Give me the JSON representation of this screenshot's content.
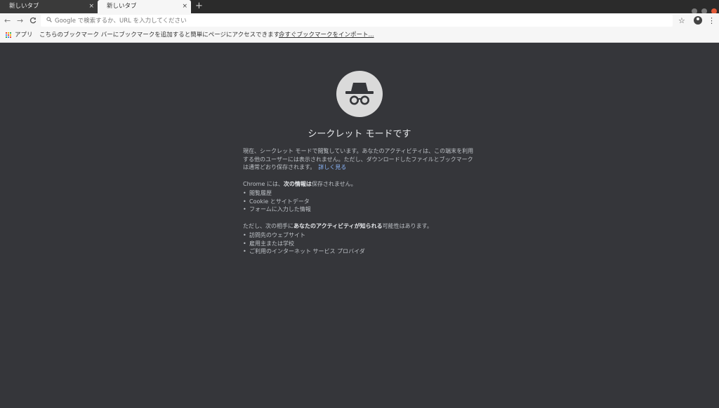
{
  "tabs": [
    {
      "label": "新しいタブ",
      "active": false
    },
    {
      "label": "新しいタブ",
      "active": true
    }
  ],
  "tabstrip": {
    "close_glyph": "×",
    "newtab_glyph": "+"
  },
  "toolbar": {
    "back_glyph": "←",
    "forward_glyph": "→",
    "reload_glyph": "C",
    "omnibox_placeholder": "Google で検索するか、URL を入力してください",
    "star_glyph": "☆",
    "menu_glyph": "⋮"
  },
  "bookmarks": {
    "apps_label": "アプリ",
    "message": "こちらのブックマーク バーにブックマークを追加すると簡単にページにアクセスできます。",
    "import_link": "今すぐブックマークをインポート..."
  },
  "incognito": {
    "title": "シークレット モードです",
    "intro": "現在、シークレット モードで閲覧しています。あなたのアクティビティは、この端末を利用する他のユーザーには表示されません。ただし、ダウンロードしたファイルとブックマークは通常どおり保存されます。",
    "learn_more": "詳しく見る",
    "not_saved_prefix": "Chrome には、",
    "not_saved_bold": "次の情報は",
    "not_saved_suffix": "保存されません。",
    "not_saved_items": [
      "閲覧履歴",
      "Cookie とサイトデータ",
      "フォームに入力した情報"
    ],
    "visible_prefix": "ただし、次の相手に",
    "visible_bold": "あなたのアクティビティが知られる",
    "visible_suffix": "可能性はあります。",
    "visible_items": [
      "訪問先のウェブサイト",
      "雇用主または学校",
      "ご利用のインターネット サービス プロバイダ"
    ]
  },
  "colors": {
    "background": "#35363a",
    "link": "#8ab4f8",
    "avatar_circle": "#dadada",
    "icon_dark": "#35363a"
  },
  "icons": {
    "apps": "apps-grid-icon",
    "incognito": "incognito-hat-glasses-icon"
  }
}
